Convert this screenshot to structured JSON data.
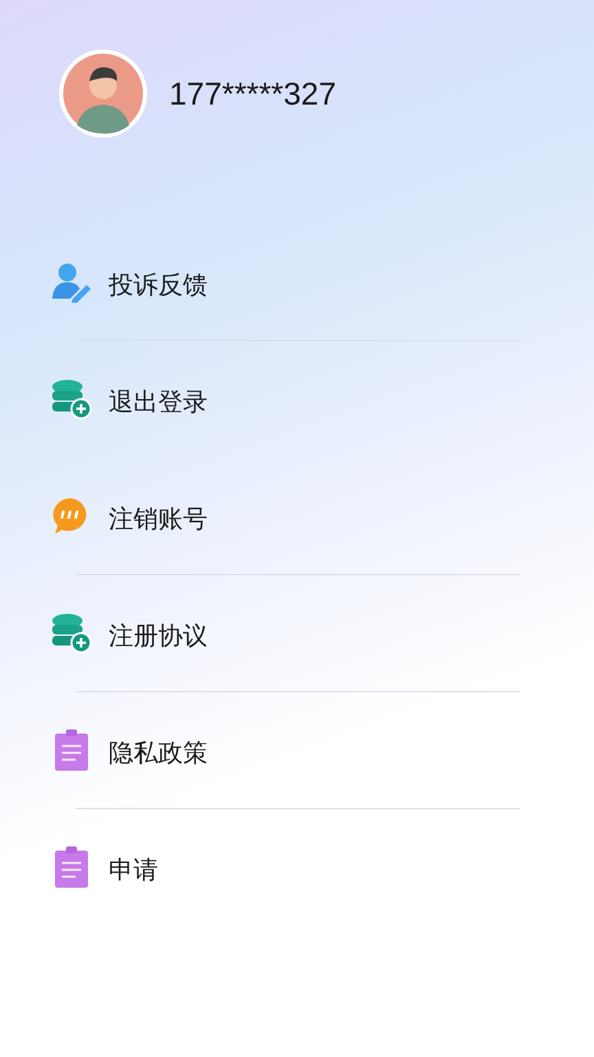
{
  "profile": {
    "phone": "177*****327"
  },
  "menu": [
    {
      "label": "投诉反馈",
      "kind": "feedback",
      "divider": true
    },
    {
      "label": "退出登录",
      "kind": "database",
      "divider": false
    },
    {
      "label": "注销账号",
      "kind": "chat",
      "divider": true
    },
    {
      "label": "注册协议",
      "kind": "database",
      "divider": true
    },
    {
      "label": "隐私政策",
      "kind": "clipboard",
      "divider": true
    },
    {
      "label": "申请",
      "kind": "clipboard",
      "divider": false
    }
  ]
}
